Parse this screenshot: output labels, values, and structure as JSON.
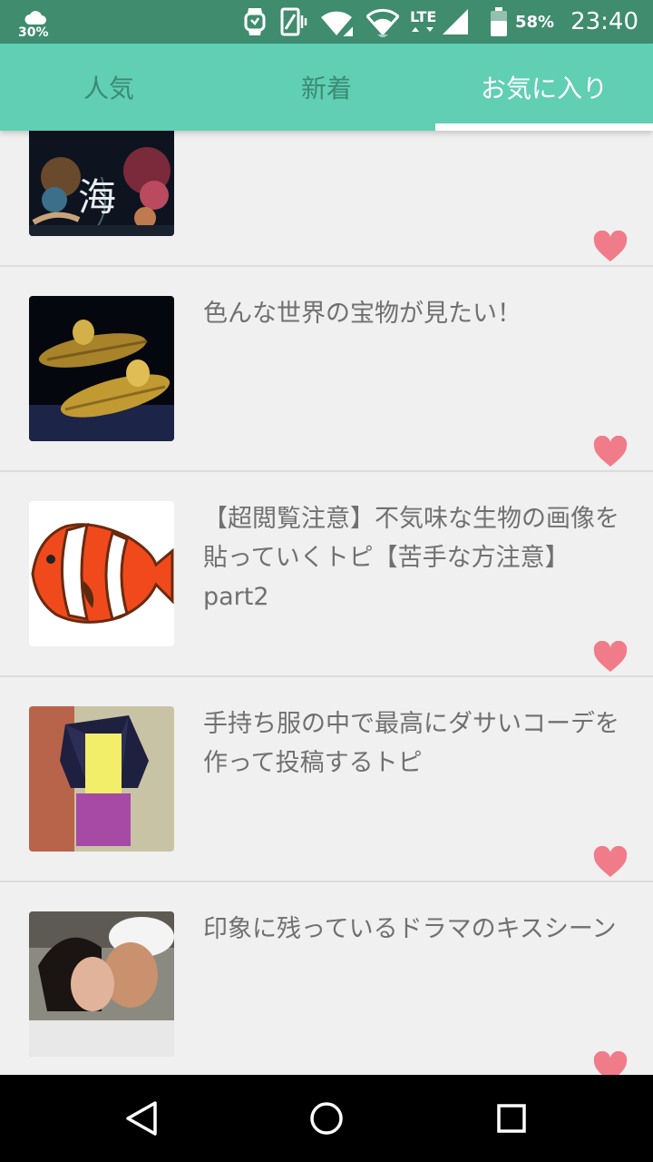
{
  "status_bar": {
    "weather_percent": "30%",
    "network": "LTE",
    "battery_percent": "58%",
    "time": "23:40",
    "icons": [
      "cloud-icon",
      "watch-icon",
      "vibrate-icon",
      "wifi-calling-icon",
      "wifi-icon",
      "lte-signal-icon",
      "battery-icon"
    ]
  },
  "tabs": [
    {
      "label": "人気",
      "active": false
    },
    {
      "label": "新着",
      "active": false
    },
    {
      "label": "お気に入り",
      "active": true
    }
  ],
  "items": [
    {
      "title": "",
      "thumbnail": "ocean-exhibition-poster",
      "thumb_caption": "海",
      "favorited": true
    },
    {
      "title": "色んな世界の宝物が見たい！",
      "thumbnail": "golden-coffins",
      "favorited": true
    },
    {
      "title": "【超閲覧注意】不気味な生物の画像を貼っていくトピ【苦手な方注意】part2",
      "thumbnail": "clownfish-illustration",
      "favorited": true
    },
    {
      "title": "手持ち服の中で最高にダサいコーデを作って投稿するトピ",
      "thumbnail": "clothes-outfit-photo",
      "favorited": true
    },
    {
      "title": "印象に残っているドラマのキスシーン",
      "thumbnail": "drama-kiss-scene",
      "favorited": true
    }
  ],
  "colors": {
    "status_bar": "#3f8c6f",
    "tab_bar": "#60cfb3",
    "tab_inactive": "#3b8a76",
    "tab_active": "#ffffff",
    "heart": "#f07c8a",
    "background": "#f0f0f0"
  },
  "nav_bar": {
    "buttons": [
      "back-icon",
      "home-icon",
      "recents-icon"
    ]
  }
}
